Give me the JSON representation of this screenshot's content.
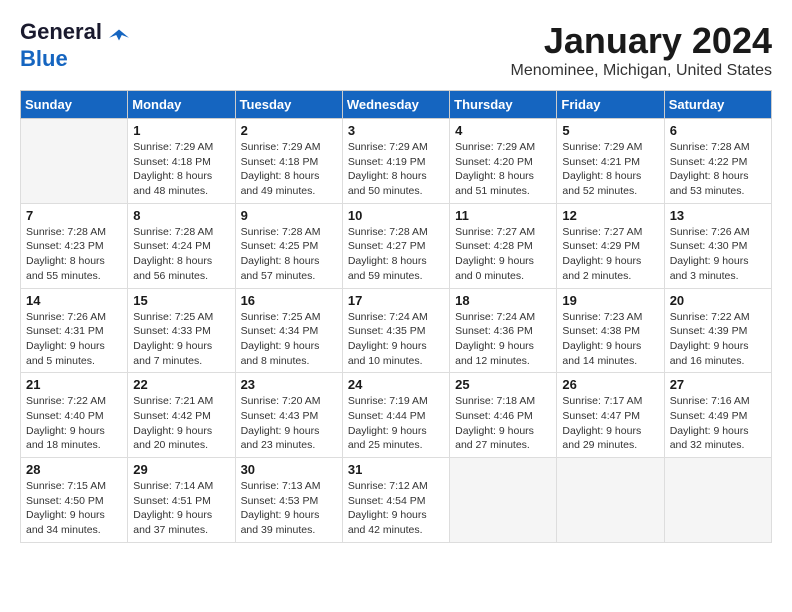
{
  "header": {
    "logo_line1": "General",
    "logo_line2": "Blue",
    "month_title": "January 2024",
    "subtitle": "Menominee, Michigan, United States"
  },
  "weekdays": [
    "Sunday",
    "Monday",
    "Tuesday",
    "Wednesday",
    "Thursday",
    "Friday",
    "Saturday"
  ],
  "weeks": [
    [
      {
        "day": "",
        "sunrise": "",
        "sunset": "",
        "daylight": "",
        "empty": true
      },
      {
        "day": "1",
        "sunrise": "Sunrise: 7:29 AM",
        "sunset": "Sunset: 4:18 PM",
        "daylight": "Daylight: 8 hours and 48 minutes."
      },
      {
        "day": "2",
        "sunrise": "Sunrise: 7:29 AM",
        "sunset": "Sunset: 4:18 PM",
        "daylight": "Daylight: 8 hours and 49 minutes."
      },
      {
        "day": "3",
        "sunrise": "Sunrise: 7:29 AM",
        "sunset": "Sunset: 4:19 PM",
        "daylight": "Daylight: 8 hours and 50 minutes."
      },
      {
        "day": "4",
        "sunrise": "Sunrise: 7:29 AM",
        "sunset": "Sunset: 4:20 PM",
        "daylight": "Daylight: 8 hours and 51 minutes."
      },
      {
        "day": "5",
        "sunrise": "Sunrise: 7:29 AM",
        "sunset": "Sunset: 4:21 PM",
        "daylight": "Daylight: 8 hours and 52 minutes."
      },
      {
        "day": "6",
        "sunrise": "Sunrise: 7:28 AM",
        "sunset": "Sunset: 4:22 PM",
        "daylight": "Daylight: 8 hours and 53 minutes."
      }
    ],
    [
      {
        "day": "7",
        "sunrise": "Sunrise: 7:28 AM",
        "sunset": "Sunset: 4:23 PM",
        "daylight": "Daylight: 8 hours and 55 minutes."
      },
      {
        "day": "8",
        "sunrise": "Sunrise: 7:28 AM",
        "sunset": "Sunset: 4:24 PM",
        "daylight": "Daylight: 8 hours and 56 minutes."
      },
      {
        "day": "9",
        "sunrise": "Sunrise: 7:28 AM",
        "sunset": "Sunset: 4:25 PM",
        "daylight": "Daylight: 8 hours and 57 minutes."
      },
      {
        "day": "10",
        "sunrise": "Sunrise: 7:28 AM",
        "sunset": "Sunset: 4:27 PM",
        "daylight": "Daylight: 8 hours and 59 minutes."
      },
      {
        "day": "11",
        "sunrise": "Sunrise: 7:27 AM",
        "sunset": "Sunset: 4:28 PM",
        "daylight": "Daylight: 9 hours and 0 minutes."
      },
      {
        "day": "12",
        "sunrise": "Sunrise: 7:27 AM",
        "sunset": "Sunset: 4:29 PM",
        "daylight": "Daylight: 9 hours and 2 minutes."
      },
      {
        "day": "13",
        "sunrise": "Sunrise: 7:26 AM",
        "sunset": "Sunset: 4:30 PM",
        "daylight": "Daylight: 9 hours and 3 minutes."
      }
    ],
    [
      {
        "day": "14",
        "sunrise": "Sunrise: 7:26 AM",
        "sunset": "Sunset: 4:31 PM",
        "daylight": "Daylight: 9 hours and 5 minutes."
      },
      {
        "day": "15",
        "sunrise": "Sunrise: 7:25 AM",
        "sunset": "Sunset: 4:33 PM",
        "daylight": "Daylight: 9 hours and 7 minutes."
      },
      {
        "day": "16",
        "sunrise": "Sunrise: 7:25 AM",
        "sunset": "Sunset: 4:34 PM",
        "daylight": "Daylight: 9 hours and 8 minutes."
      },
      {
        "day": "17",
        "sunrise": "Sunrise: 7:24 AM",
        "sunset": "Sunset: 4:35 PM",
        "daylight": "Daylight: 9 hours and 10 minutes."
      },
      {
        "day": "18",
        "sunrise": "Sunrise: 7:24 AM",
        "sunset": "Sunset: 4:36 PM",
        "daylight": "Daylight: 9 hours and 12 minutes."
      },
      {
        "day": "19",
        "sunrise": "Sunrise: 7:23 AM",
        "sunset": "Sunset: 4:38 PM",
        "daylight": "Daylight: 9 hours and 14 minutes."
      },
      {
        "day": "20",
        "sunrise": "Sunrise: 7:22 AM",
        "sunset": "Sunset: 4:39 PM",
        "daylight": "Daylight: 9 hours and 16 minutes."
      }
    ],
    [
      {
        "day": "21",
        "sunrise": "Sunrise: 7:22 AM",
        "sunset": "Sunset: 4:40 PM",
        "daylight": "Daylight: 9 hours and 18 minutes."
      },
      {
        "day": "22",
        "sunrise": "Sunrise: 7:21 AM",
        "sunset": "Sunset: 4:42 PM",
        "daylight": "Daylight: 9 hours and 20 minutes."
      },
      {
        "day": "23",
        "sunrise": "Sunrise: 7:20 AM",
        "sunset": "Sunset: 4:43 PM",
        "daylight": "Daylight: 9 hours and 23 minutes."
      },
      {
        "day": "24",
        "sunrise": "Sunrise: 7:19 AM",
        "sunset": "Sunset: 4:44 PM",
        "daylight": "Daylight: 9 hours and 25 minutes."
      },
      {
        "day": "25",
        "sunrise": "Sunrise: 7:18 AM",
        "sunset": "Sunset: 4:46 PM",
        "daylight": "Daylight: 9 hours and 27 minutes."
      },
      {
        "day": "26",
        "sunrise": "Sunrise: 7:17 AM",
        "sunset": "Sunset: 4:47 PM",
        "daylight": "Daylight: 9 hours and 29 minutes."
      },
      {
        "day": "27",
        "sunrise": "Sunrise: 7:16 AM",
        "sunset": "Sunset: 4:49 PM",
        "daylight": "Daylight: 9 hours and 32 minutes."
      }
    ],
    [
      {
        "day": "28",
        "sunrise": "Sunrise: 7:15 AM",
        "sunset": "Sunset: 4:50 PM",
        "daylight": "Daylight: 9 hours and 34 minutes."
      },
      {
        "day": "29",
        "sunrise": "Sunrise: 7:14 AM",
        "sunset": "Sunset: 4:51 PM",
        "daylight": "Daylight: 9 hours and 37 minutes."
      },
      {
        "day": "30",
        "sunrise": "Sunrise: 7:13 AM",
        "sunset": "Sunset: 4:53 PM",
        "daylight": "Daylight: 9 hours and 39 minutes."
      },
      {
        "day": "31",
        "sunrise": "Sunrise: 7:12 AM",
        "sunset": "Sunset: 4:54 PM",
        "daylight": "Daylight: 9 hours and 42 minutes."
      },
      {
        "day": "",
        "sunrise": "",
        "sunset": "",
        "daylight": "",
        "empty": true
      },
      {
        "day": "",
        "sunrise": "",
        "sunset": "",
        "daylight": "",
        "empty": true
      },
      {
        "day": "",
        "sunrise": "",
        "sunset": "",
        "daylight": "",
        "empty": true
      }
    ]
  ]
}
